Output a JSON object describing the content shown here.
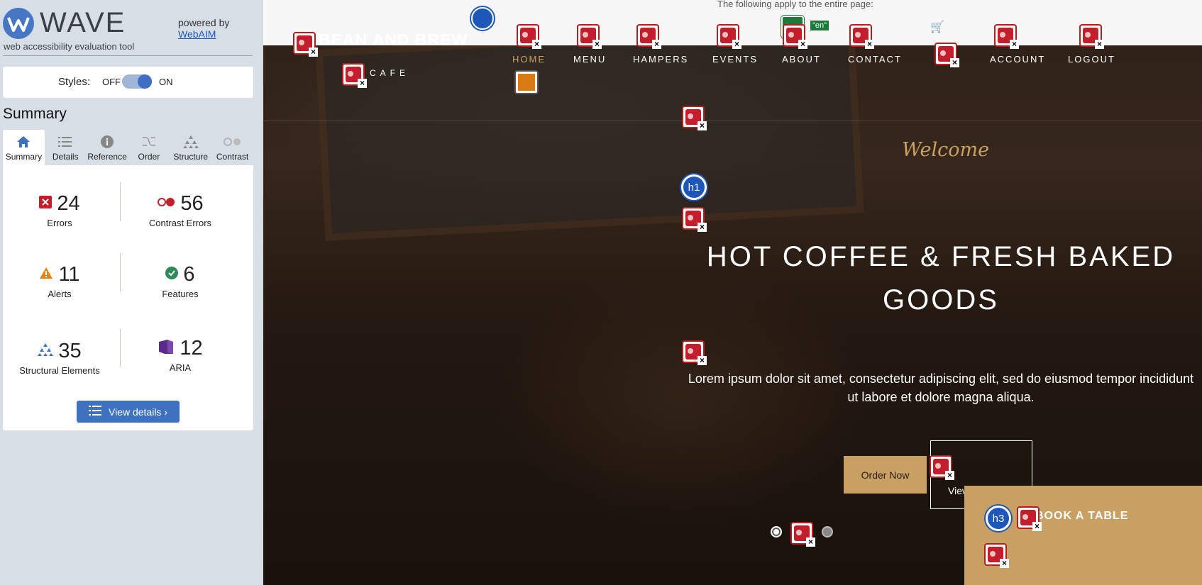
{
  "wave": {
    "app_name": "WAVE",
    "tagline": "web accessibility evaluation tool",
    "powered_by": "powered by",
    "webaim_link": "WebAIM",
    "styles_label": "Styles:",
    "styles_off": "OFF",
    "styles_on": "ON",
    "summary_heading": "Summary",
    "tabs": [
      {
        "label": "Summary",
        "icon": "home-icon",
        "active": true
      },
      {
        "label": "Details",
        "icon": "list-icon"
      },
      {
        "label": "Reference",
        "icon": "info-icon"
      },
      {
        "label": "Order",
        "icon": "order-icon"
      },
      {
        "label": "Structure",
        "icon": "structure-icon"
      },
      {
        "label": "Contrast",
        "icon": "contrast-icon"
      }
    ],
    "stats": {
      "errors": {
        "count": "24",
        "label": "Errors",
        "color": "#c41e2c"
      },
      "contrast_errors": {
        "count": "56",
        "label": "Contrast Errors",
        "color": "#c41e2c"
      },
      "alerts": {
        "count": "11",
        "label": "Alerts",
        "color": "#e6850e"
      },
      "features": {
        "count": "6",
        "label": "Features",
        "color": "#2e8b57"
      },
      "structural": {
        "count": "35",
        "label": "Structural Elements",
        "color": "#3e72c0"
      },
      "aria": {
        "count": "12",
        "label": "ARIA",
        "color": "#5b2a8a"
      }
    },
    "view_details": "View details ›"
  },
  "site": {
    "page_notice": "The following apply to the entire page:",
    "lang_tag": "\"en\"",
    "brand": "BEAN AND BREW",
    "brand_sub": "CAFE",
    "nav": [
      "HOME",
      "MENU",
      "HAMPERS",
      "EVENTS",
      "ABOUT",
      "CONTACT",
      "ACCOUNT",
      "LOGOUT"
    ],
    "welcome": "Welcome",
    "hero_title": "HOT COFFEE & FRESH BAKED GOODS",
    "hero_text": "Lorem ipsum dolor sit amet, consectetur adipiscing elit, sed do eiusmod tempor incididunt ut labore et dolore magna aliqua.",
    "order_now": "Order Now",
    "view_menu": "View",
    "book_table": "BOOK A TABLE",
    "h1_badge": "h1",
    "h3_badge": "h3",
    "accent_color": "#c9a063"
  }
}
